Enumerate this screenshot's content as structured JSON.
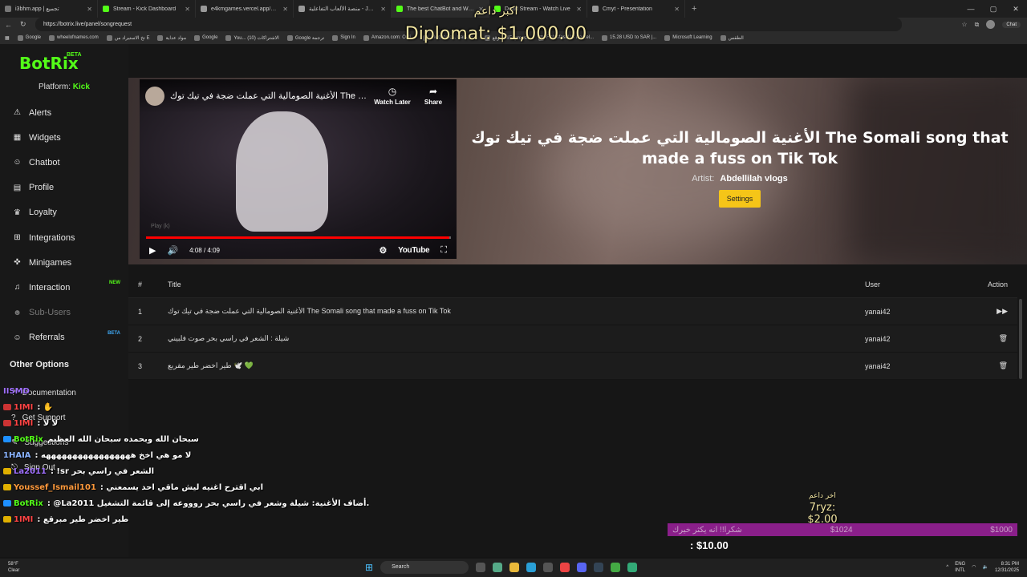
{
  "browser": {
    "tabs": [
      {
        "label": "i3bhm.app | تجميع",
        "color": "#777"
      },
      {
        "label": "Stream - Kick Dashboard",
        "color": "#53fc18"
      },
      {
        "label": "e4kmgames.vercel.app/games/w",
        "color": "#999"
      },
      {
        "label": "منصة الألعاب التفاعلية - Jawlah | جولة",
        "color": "#999"
      },
      {
        "label": "The best ChatBot and Widgets",
        "color": "#53fc18",
        "active": true
      },
      {
        "label": "Dead Stream - Watch Live",
        "color": "#53fc18"
      },
      {
        "label": "Cmyt - Presentation",
        "color": "#999"
      }
    ],
    "url": "https://botrix.live/panel/songrequest",
    "chat_label": "Chat",
    "bookmarks": [
      "Google",
      "wheelofnames.com",
      "تخ الاستيراد من E",
      "مواد عداية",
      "Google",
      "You... الاشتراكات (10)",
      "Google ترجمة",
      "Sign In",
      "Amazon.com: Onli...",
      "Electronics, Cars, F...",
      "موقع AliExpress...",
      "Fishisfast US Parcel...",
      "15.28 USD to SAR |...",
      "Microsoft Learning",
      "الطقس"
    ]
  },
  "overlay": {
    "top_arabic": "اكبر داعم",
    "top_amount": "Diplomat: $1,000.00",
    "last_arabic": "اخر داعم",
    "last_amount": "7ryz: $2.00",
    "goal_text": "شكرا!! انه يكثر خيرك",
    "goal_mid": "$1024",
    "goal_max": "$1000",
    "goal_current": ": $10.00"
  },
  "sidebar": {
    "logo": "BotRix",
    "logo_badge": "BETA",
    "platform_label": "Platform:",
    "platform_value": "Kick",
    "items": [
      {
        "label": "Alerts",
        "icon": "⚠"
      },
      {
        "label": "Widgets",
        "icon": "▦"
      },
      {
        "label": "Chatbot",
        "icon": "☺"
      },
      {
        "label": "Profile",
        "icon": "▤"
      },
      {
        "label": "Loyalty",
        "icon": "♛"
      },
      {
        "label": "Integrations",
        "icon": "⊞"
      },
      {
        "label": "Minigames",
        "icon": "✜"
      },
      {
        "label": "Interaction",
        "icon": "♫",
        "badge": "NEW"
      },
      {
        "label": "Sub-Users",
        "icon": "☻",
        "disabled": true
      },
      {
        "label": "Referrals",
        "icon": "☺",
        "badge": "BETA"
      }
    ],
    "other_title": "Other Options",
    "other_items": [
      "Documentation",
      "Get Support",
      "Suggestions",
      "Sign Out"
    ]
  },
  "player": {
    "title": "الأغنية الصومالية التي عملت ضجة في تيك توك The Somali s...",
    "watch_later": "Watch Later",
    "share": "Share",
    "play_hint": "Play (k)",
    "time": "4:08 / 4:09",
    "progress": 0.996,
    "logo": "YouTube"
  },
  "now_playing": {
    "title": "الأغنية الصومالية التي عملت ضجة في تيك توك The Somali song that made a fuss on Tik Tok",
    "artist_label": "Artist:",
    "artist": "Abdellilah vlogs",
    "settings": "Settings"
  },
  "queue": {
    "headers": {
      "num": "#",
      "title": "Title",
      "user": "User",
      "action": "Action"
    },
    "rows": [
      {
        "num": "1",
        "title": "الأغنية الصومالية التي عملت ضجة في تيك توك The Somali song that made a fuss on Tik Tok",
        "user": "yanai42",
        "action": "▶▶"
      },
      {
        "num": "2",
        "title": "شيلة : الشعر في راسي بحر صوت فلبيني",
        "user": "yanai42",
        "action": "🗑"
      },
      {
        "num": "3",
        "title": "طير اخضر طير مقربع 🕊️ 💚",
        "user": "yanai42",
        "action": "🗑"
      }
    ]
  },
  "chat": [
    {
      "user": "IISMD",
      "text": "",
      "color": "#a070ff",
      "badge": ""
    },
    {
      "user": "1IMI",
      "text": ": ✋",
      "color": "#ff4444",
      "badge": "red"
    },
    {
      "user": "1IMI",
      "text": ": لا لا",
      "color": "#ff4444",
      "badge": "red"
    },
    {
      "user": "BotRix",
      "text": "سبحان الله وبحمده سبحان الله العظيم",
      "color": "#53fc18",
      "badge": "blue"
    },
    {
      "user": "1HAIA",
      "text": ": لا مو هي اخخ هههههههههههههههههه",
      "color": "#8ab4ff",
      "badge": ""
    },
    {
      "user": "La2011",
      "text": ": !sr الشعر في راسي بحر",
      "color": "#a070ff",
      "badge": "yellow"
    },
    {
      "user": "Youssef_Ismail101",
      "text": ": ابي اقترح اغنيه ليش ماقي احد يسمعني",
      "color": "#ff9a3c",
      "badge": "yellow"
    },
    {
      "user": "BotRix",
      "text": ": @La2011 أضاف الأغنية: شيلة وشعر في راسي بحر روووعه إلى قائمة التشغيل.",
      "color": "#53fc18",
      "badge": "blue"
    },
    {
      "user": "1IMI",
      "text": ": طير اخضر طير مبرقع",
      "color": "#ff4444",
      "badge": "yellow"
    }
  ],
  "taskbar": {
    "weather_temp": "58°F",
    "weather_desc": "Clear",
    "search": "Search",
    "lang1": "ENG",
    "lang2": "INTL",
    "time": "8:31 PM",
    "date": "12/31/2025"
  }
}
